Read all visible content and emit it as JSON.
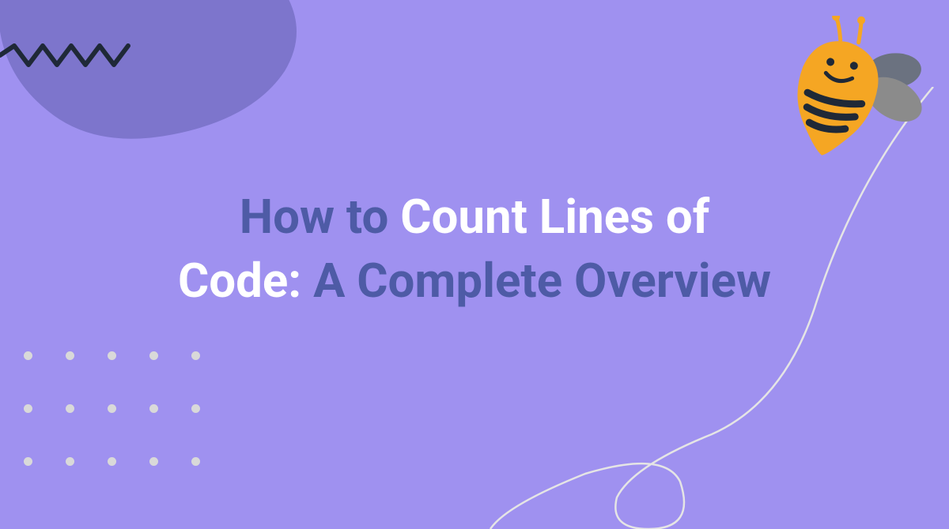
{
  "title": {
    "part1": "How to ",
    "part2": "Count Lines of Code: ",
    "part3": "A Complete Overview"
  },
  "colors": {
    "background": "#9f91f0",
    "blob": "#7d75cc",
    "title_dark": "#4e5ba6",
    "title_light": "#ffffff",
    "zigzag": "#1f2937",
    "dot": "#d9d9d9",
    "curve": "#e5e5e5",
    "bee_body": "#f5a623",
    "bee_wing": "#6b7280"
  },
  "icons": {
    "bee": "bee-mascot",
    "blob": "decorative-blob",
    "zigzag": "decorative-zigzag",
    "dots": "decorative-dot-grid",
    "curve": "decorative-curve-line"
  }
}
